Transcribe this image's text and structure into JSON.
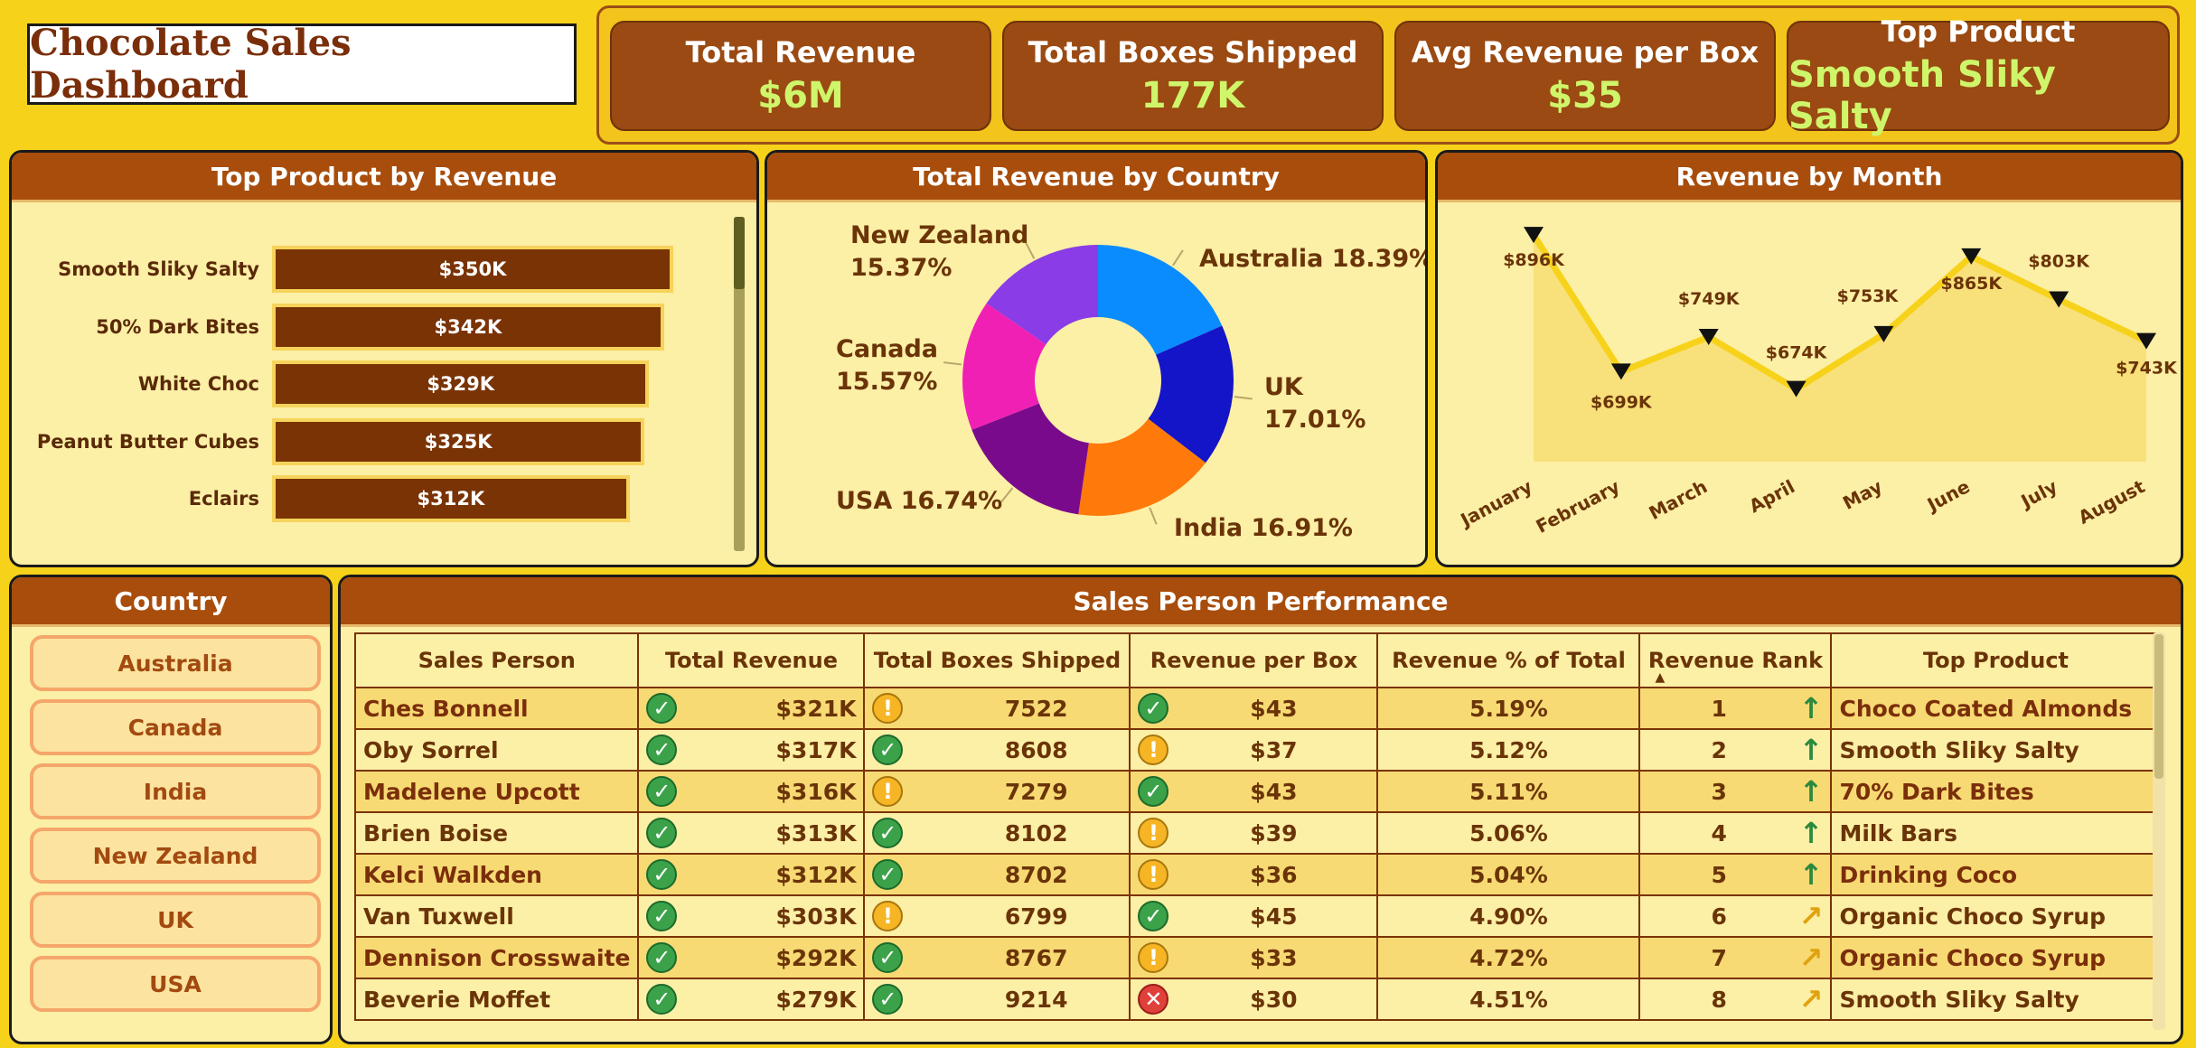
{
  "header": {
    "title": "Chocolate Sales Dashboard"
  },
  "kpis": [
    {
      "label": "Total Revenue",
      "value": "$6M"
    },
    {
      "label": "Total Boxes Shipped",
      "value": "177K"
    },
    {
      "label": "Avg Revenue per Box",
      "value": "$35"
    },
    {
      "label": "Top Product",
      "value": "Smooth Sliky Salty"
    }
  ],
  "panels": {
    "top_product": "Top Product by Revenue",
    "by_country": "Total Revenue by Country",
    "by_month": "Revenue by Month",
    "country_filter": "Country",
    "sales_person": "Sales Person Performance"
  },
  "chart_data": [
    {
      "type": "bar",
      "title": "Top Product by Revenue",
      "categories": [
        "Smooth Sliky Salty",
        "50% Dark Bites",
        "White Choc",
        "Peanut Butter Cubes",
        "Eclairs"
      ],
      "values": [
        350,
        342,
        329,
        325,
        312
      ],
      "value_labels": [
        "$350K",
        "$342K",
        "$329K",
        "$325K",
        "$312K"
      ],
      "orientation": "horizontal",
      "xlim": [
        0,
        350
      ],
      "colors": {
        "bar": "#7A3305",
        "bar_border": "#F6D35A"
      }
    },
    {
      "type": "pie",
      "title": "Total Revenue by Country",
      "donut": true,
      "slices": [
        {
          "label": "Australia",
          "pct": 18.39,
          "pct_label": "18.39%",
          "color": "#0A8CFF"
        },
        {
          "label": "UK",
          "pct": 17.01,
          "pct_label": "17.01%",
          "color": "#1414C8"
        },
        {
          "label": "India",
          "pct": 16.91,
          "pct_label": "16.91%",
          "color": "#FF7A0A"
        },
        {
          "label": "USA",
          "pct": 16.74,
          "pct_label": "16.74%",
          "color": "#7A0A8C"
        },
        {
          "label": "Canada",
          "pct": 15.57,
          "pct_label": "15.57%",
          "color": "#F020B4"
        },
        {
          "label": "New Zealand",
          "pct": 15.37,
          "pct_label": "15.37%",
          "color": "#8A3CE6"
        }
      ]
    },
    {
      "type": "line",
      "title": "Revenue by Month",
      "categories": [
        "January",
        "February",
        "March",
        "April",
        "May",
        "June",
        "July",
        "August"
      ],
      "values": [
        896,
        699,
        749,
        674,
        753,
        865,
        803,
        743
      ],
      "value_labels": [
        "$896K",
        "$699K",
        "$749K",
        "$674K",
        "$753K",
        "$865K",
        "$803K",
        "$743K"
      ],
      "ylim": [
        650,
        900
      ],
      "area": true,
      "colors": {
        "line": "#F7D21A",
        "area": "#F8E07A",
        "marker": "#111111"
      }
    }
  ],
  "country_filter": {
    "items": [
      "Australia",
      "Canada",
      "India",
      "New Zealand",
      "UK",
      "USA"
    ]
  },
  "table": {
    "columns": [
      "Sales Person",
      "Total Revenue",
      "Total Boxes Shipped",
      "Revenue per Box",
      "Revenue % of Total",
      "Revenue Rank",
      "Top Product"
    ],
    "rows": [
      {
        "name": "Ches Bonnell",
        "revenue": "$321K",
        "rev_icon": "ok",
        "boxes": "7522",
        "box_icon": "warn",
        "rpb": "$43",
        "rpb_icon": "ok",
        "pct": "5.19%",
        "rank": "1",
        "trend": "up",
        "product": "Choco Coated Almonds"
      },
      {
        "name": "Oby Sorrel",
        "revenue": "$317K",
        "rev_icon": "ok",
        "boxes": "8608",
        "box_icon": "ok",
        "rpb": "$37",
        "rpb_icon": "warn",
        "pct": "5.12%",
        "rank": "2",
        "trend": "up",
        "product": "Smooth Sliky Salty"
      },
      {
        "name": "Madelene Upcott",
        "revenue": "$316K",
        "rev_icon": "ok",
        "boxes": "7279",
        "box_icon": "warn",
        "rpb": "$43",
        "rpb_icon": "ok",
        "pct": "5.11%",
        "rank": "3",
        "trend": "up",
        "product": "70% Dark Bites"
      },
      {
        "name": "Brien Boise",
        "revenue": "$313K",
        "rev_icon": "ok",
        "boxes": "8102",
        "box_icon": "ok",
        "rpb": "$39",
        "rpb_icon": "warn",
        "pct": "5.06%",
        "rank": "4",
        "trend": "up",
        "product": "Milk Bars"
      },
      {
        "name": "Kelci Walkden",
        "revenue": "$312K",
        "rev_icon": "ok",
        "boxes": "8702",
        "box_icon": "ok",
        "rpb": "$36",
        "rpb_icon": "warn",
        "pct": "5.04%",
        "rank": "5",
        "trend": "up",
        "product": "Drinking Coco"
      },
      {
        "name": "Van Tuxwell",
        "revenue": "$303K",
        "rev_icon": "ok",
        "boxes": "6799",
        "box_icon": "warn",
        "rpb": "$45",
        "rpb_icon": "ok",
        "pct": "4.90%",
        "rank": "6",
        "trend": "diag",
        "product": "Organic Choco Syrup"
      },
      {
        "name": "Dennison Crosswaite",
        "revenue": "$292K",
        "rev_icon": "ok",
        "boxes": "8767",
        "box_icon": "ok",
        "rpb": "$33",
        "rpb_icon": "warn",
        "pct": "4.72%",
        "rank": "7",
        "trend": "diag",
        "product": "Organic Choco Syrup"
      },
      {
        "name": "Beverie Moffet",
        "revenue": "$279K",
        "rev_icon": "ok",
        "boxes": "9214",
        "box_icon": "ok",
        "rpb": "$30",
        "rpb_icon": "bad",
        "pct": "4.51%",
        "rank": "8",
        "trend": "diag",
        "product": "Smooth Sliky Salty"
      }
    ]
  }
}
